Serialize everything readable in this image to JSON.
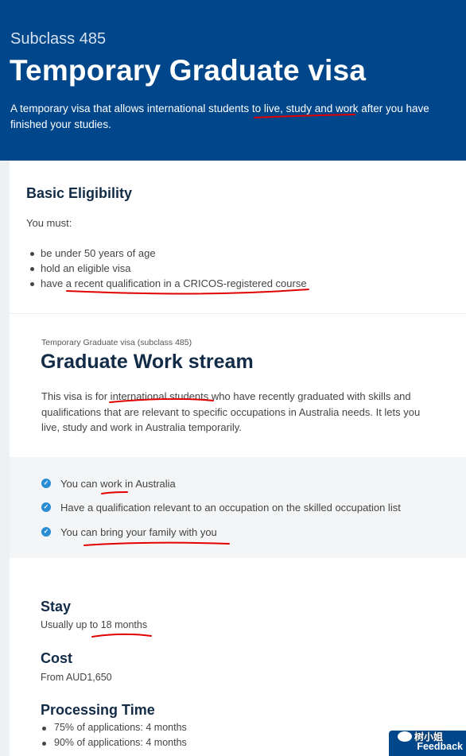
{
  "hero": {
    "subclass": "Subclass 485",
    "title": "Temporary Graduate visa",
    "description": "A temporary visa that allows international students to live, study and work after you have finished your studies."
  },
  "basic": {
    "heading": "Basic Eligibility",
    "intro": "You must:",
    "items": [
      "be under 50 years of age",
      "hold an eligible visa",
      "have a recent qualification in a CRICOS-registered course"
    ]
  },
  "stream": {
    "crumb": "Temporary Graduate visa (subclass 485)",
    "title": "Graduate Work stream",
    "description": "This visa is for international students who have recently graduated with skills and qualifications that are relevant to specific occupations in Australia needs. It lets you live, study and work in Australia temporarily.",
    "features": [
      "You can work in Australia",
      "Have a qualification relevant to an occupation on the skilled occupation list",
      "You can bring your family with you"
    ],
    "stay_heading": "Stay",
    "stay_value": "Usually up to 18 months",
    "cost_heading": "Cost",
    "cost_value": "From AUD1,650",
    "processing_heading": "Processing Time",
    "processing_items": [
      "75% of applications: 4 months",
      "90% of applications: 4 months"
    ]
  },
  "feedback": {
    "label": "Feedback"
  },
  "watermark": {
    "text": "树小姐"
  },
  "colors": {
    "brand_blue": "#00468a",
    "heading": "#122b46",
    "check": "#2a8dd4",
    "annotation_red": "#e00000"
  }
}
